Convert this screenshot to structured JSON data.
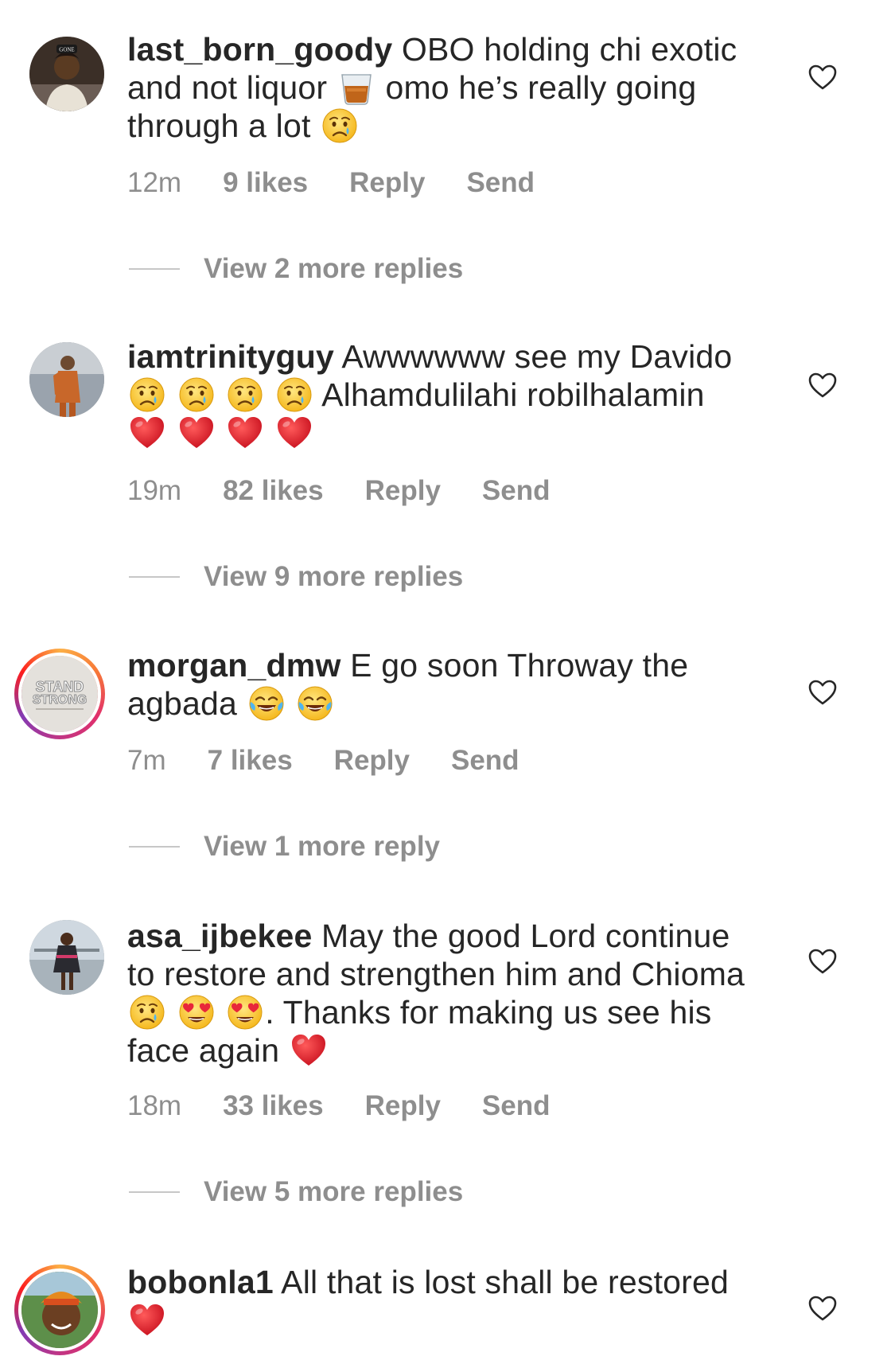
{
  "comments": [
    {
      "username": "last_born_goody",
      "text_1": "OBO holding chi exotic and not liquor",
      "text_2": "omo he’s really going through a lot",
      "emoji_1": "tumbler-glass",
      "emoji_2": "crying-face",
      "time": "12m",
      "likes": "9 likes",
      "reply": "Reply",
      "send": "Send",
      "view_replies": "View 2 more replies",
      "avatar_badge": "GONE"
    },
    {
      "username": "iamtrinityguy",
      "text_1": "Awwwwww see my Davido",
      "text_2": "Alhamdulilahi robilhalamin",
      "emojis_a": [
        "crying-face",
        "crying-face",
        "crying-face",
        "crying-face"
      ],
      "emojis_b": [
        "red-heart",
        "red-heart",
        "red-heart",
        "red-heart"
      ],
      "time": "19m",
      "likes": "82 likes",
      "reply": "Reply",
      "send": "Send",
      "view_replies": "View 9 more replies"
    },
    {
      "username": "morgan_dmw",
      "text_1": "E go soon Throway the agbada",
      "emojis": [
        "tears-of-joy",
        "tears-of-joy"
      ],
      "time": "7m",
      "likes": "7 likes",
      "reply": "Reply",
      "send": "Send",
      "view_replies": "View 1 more reply",
      "avatar_line_1": "STAND",
      "avatar_line_2": "STRONG"
    },
    {
      "username": "asa_ijbekee",
      "text_1": "May the good Lord continue to restore and strengthen him and Chioma",
      "text_2": ". Thanks for making us see his face again",
      "emojis_a": [
        "crying-face",
        "heart-eyes",
        "heart-eyes"
      ],
      "emoji_end": "red-heart",
      "time": "18m",
      "likes": "33 likes",
      "reply": "Reply",
      "send": "Send",
      "view_replies": "View 5 more replies"
    },
    {
      "username": "bobonla1",
      "text_1": "All that is lost shall be restored",
      "emoji_end": "red-heart"
    }
  ],
  "colors": {
    "text": "#262626",
    "muted": "#8e8e8e",
    "divider": "#c7c7c7",
    "background": "#ffffff"
  }
}
